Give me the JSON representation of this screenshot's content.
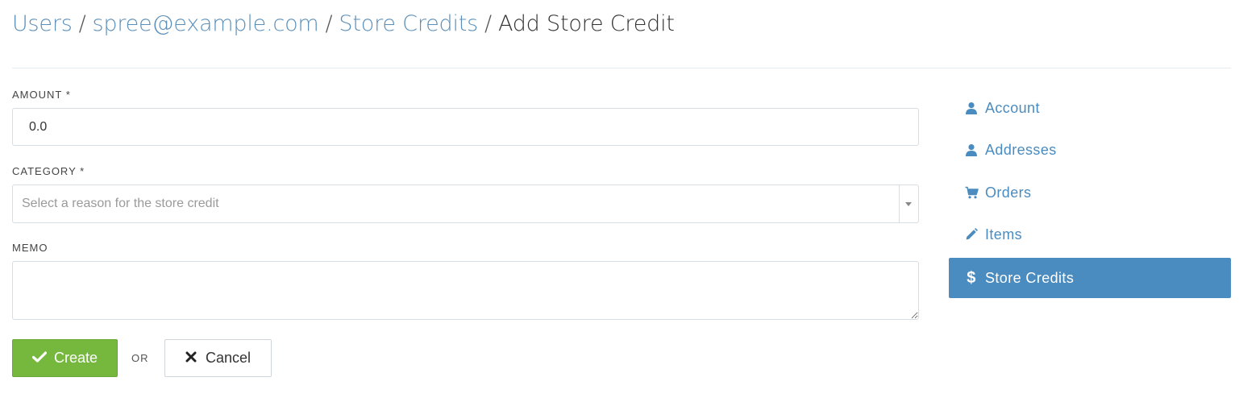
{
  "breadcrumb": {
    "items": [
      "Users",
      "spree@example.com",
      "Store Credits"
    ],
    "separator": "/",
    "current": "Add Store Credit"
  },
  "form": {
    "amount": {
      "label": "AMOUNT *",
      "value": "0.0"
    },
    "category": {
      "label": "CATEGORY *",
      "placeholder": "Select a reason for the store credit"
    },
    "memo": {
      "label": "MEMO",
      "value": ""
    }
  },
  "actions": {
    "create_label": "Create",
    "or_label": "OR",
    "cancel_label": "Cancel"
  },
  "sidebar": {
    "items": [
      {
        "label": "Account",
        "icon": "user-icon",
        "active": false
      },
      {
        "label": "Addresses",
        "icon": "user-icon",
        "active": false
      },
      {
        "label": "Orders",
        "icon": "cart-icon",
        "active": false
      },
      {
        "label": "Items",
        "icon": "pencil-icon",
        "active": false
      },
      {
        "label": "Store Credits",
        "icon": "dollar-icon",
        "active": true
      }
    ]
  },
  "colors": {
    "link": "#5b8fb9",
    "accent": "#4a8cc0",
    "success": "#76b83e",
    "border": "#d8dde2"
  }
}
